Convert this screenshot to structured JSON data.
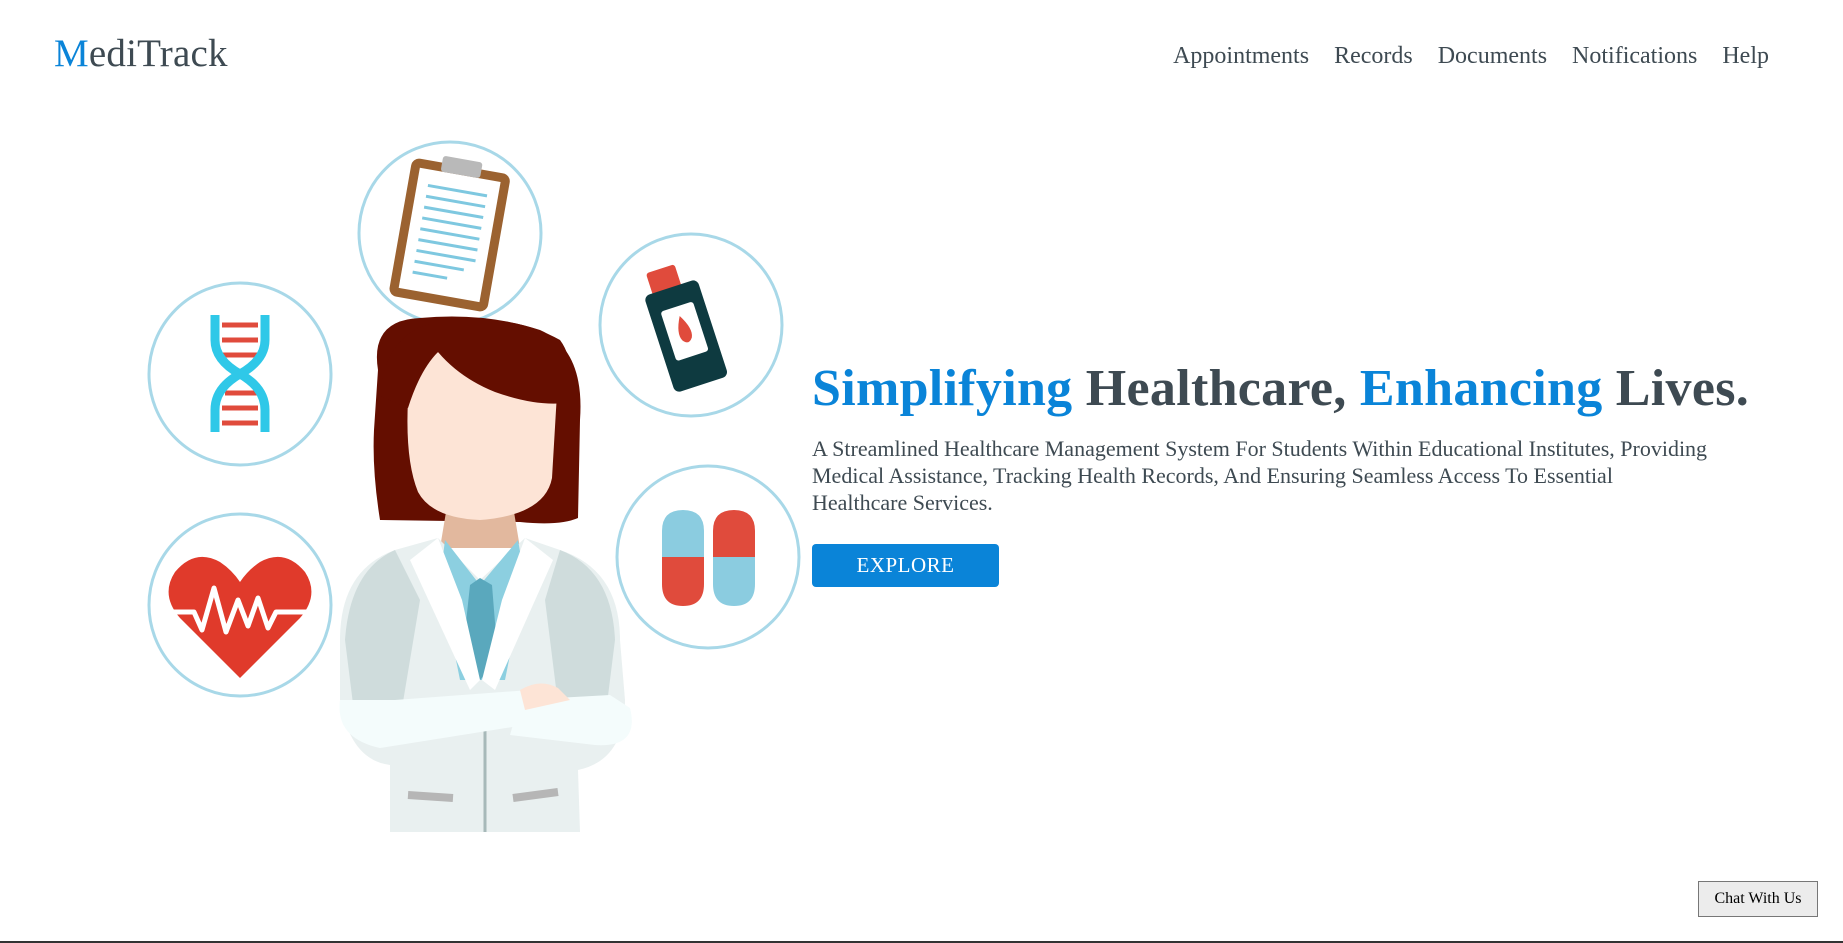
{
  "brand": {
    "initial": "M",
    "rest": "ediTrack"
  },
  "nav": {
    "items": [
      {
        "label": "Appointments"
      },
      {
        "label": "Records"
      },
      {
        "label": "Documents"
      },
      {
        "label": "Notifications"
      },
      {
        "label": "Help"
      }
    ]
  },
  "hero": {
    "headline": {
      "word1": "Simplifying",
      "word2": " Healthcare, ",
      "word3": "Enhancing",
      "word4": " Lives."
    },
    "subtext": "A Streamlined Healthcare Management System For Students Within Educational Institutes, Providing Medical Assistance, Tracking Health Records, And Ensuring Seamless Access To Essential Healthcare Services.",
    "explore_label": "EXPLORE"
  },
  "chat": {
    "label": "Chat With Us"
  },
  "illustration": {
    "icons": [
      "clipboard-icon",
      "dna-icon",
      "blood-sample-icon",
      "heartbeat-icon",
      "pills-icon",
      "doctor-figure"
    ]
  },
  "colors": {
    "accent": "#0a84d8",
    "text": "#3e4a52",
    "circle_stroke": "#a8d8e8"
  }
}
